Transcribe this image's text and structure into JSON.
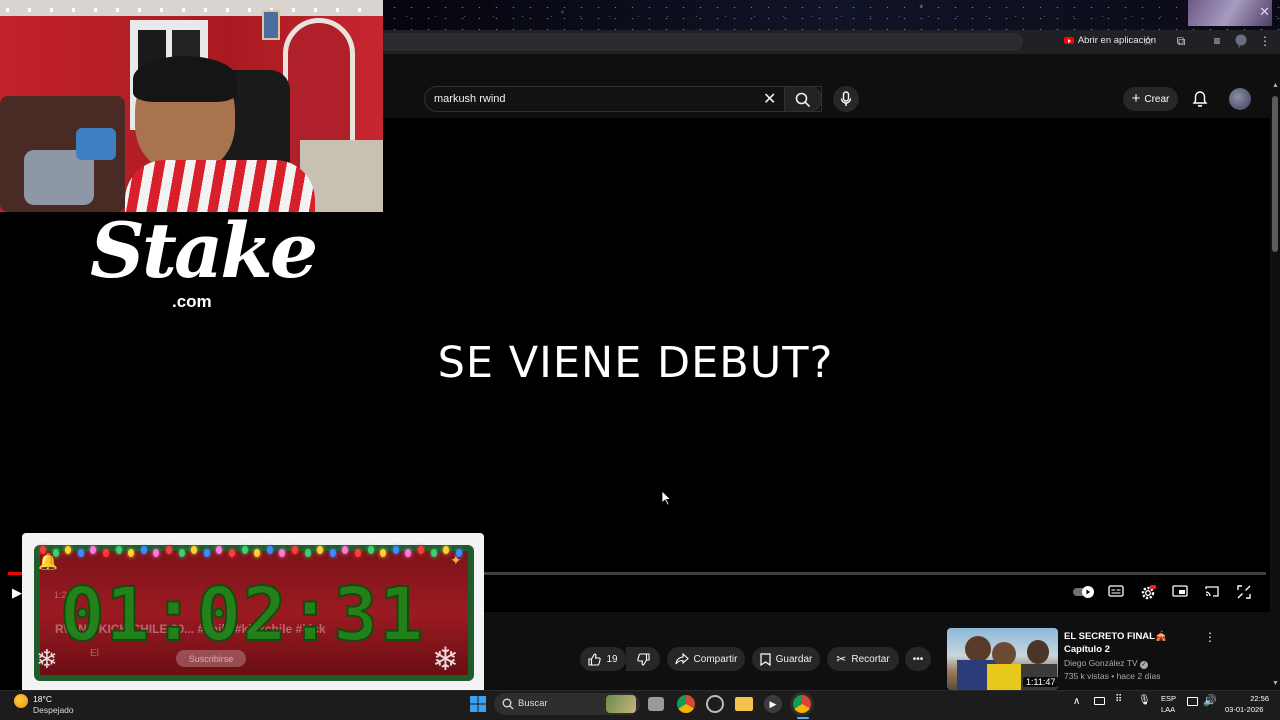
{
  "browser": {
    "open_in_app_label": "Abrir en aplicación"
  },
  "youtube": {
    "search": {
      "query": "markush rwind"
    },
    "create_label": "Crear",
    "video_text": "SE VIENE DEBUT?",
    "actions": {
      "likes": "19",
      "share_label": "Compartir",
      "save_label": "Guardar",
      "clip_label": "Recortar"
    },
    "related": {
      "title": "EL SECRETO FINAL🎪 Capítulo 2",
      "channel": "Diego González TV",
      "meta": "735 k vistas • hace 2 días",
      "duration": "1:11:47"
    }
  },
  "overlay": {
    "brand": "Stake",
    "brand_suffix": ".com",
    "timer": "01:02:31",
    "timer_ghost_text": "RWIND KICK CHILE 20... #chile #kickchile #kick",
    "timer_ghost_time": "1:28:1",
    "timer_ghost_subscribe": "Suscribirse",
    "timer_ghost_el": "El"
  },
  "taskbar": {
    "weather_temp": "18°C",
    "weather_desc": "Despejado",
    "search_label": "Buscar",
    "lang_top": "ESP",
    "lang_bottom": "LAA",
    "time": "22:56",
    "date": "03-01-2026"
  },
  "colors": {
    "yt_bg": "#0f0f0f",
    "progress_red": "#ff0000",
    "timer_green": "#1a8a1a",
    "wall_red": "#b81b22"
  }
}
